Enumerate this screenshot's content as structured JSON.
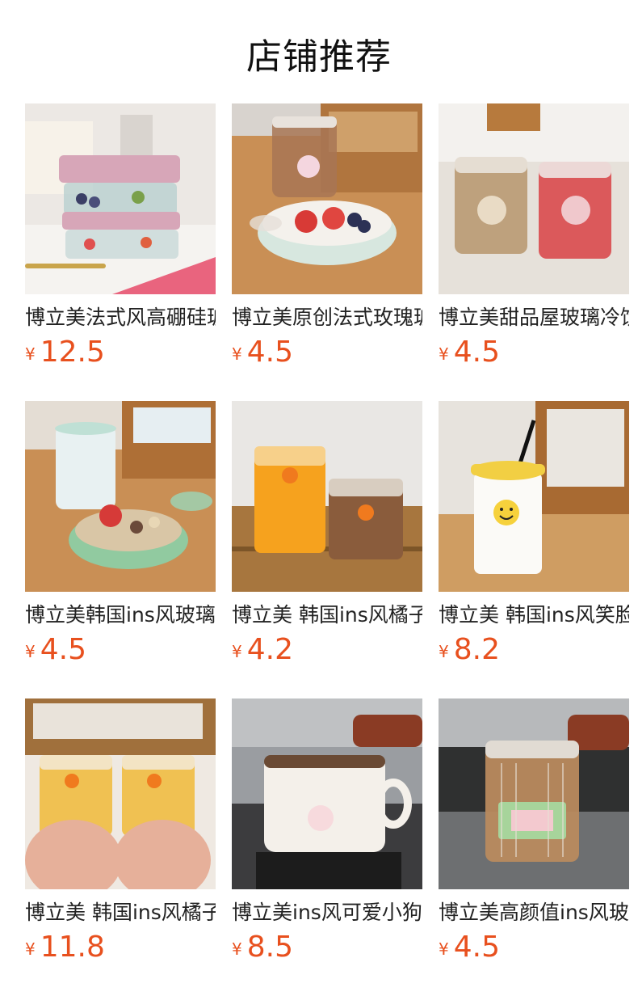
{
  "header": {
    "title": "店铺推荐"
  },
  "products": [
    {
      "name": "博立美法式风高硼硅玻璃保鲜盒",
      "currency": "¥",
      "price": "12.5"
    },
    {
      "name": "博立美原创法式玫瑰玻璃碗",
      "currency": "¥",
      "price": "4.5"
    },
    {
      "name": "博立美甜品屋玻璃冷饮杯",
      "currency": "¥",
      "price": "4.5"
    },
    {
      "name": "博立美韩国ins风玻璃碗",
      "currency": "¥",
      "price": "4.5"
    },
    {
      "name": "博立美 韩国ins风橘子玻璃杯",
      "currency": "¥",
      "price": "4.2"
    },
    {
      "name": "博立美 韩国ins风笑脸吸管杯",
      "currency": "¥",
      "price": "8.2"
    },
    {
      "name": "博立美 韩国ins风橘子小酒杯",
      "currency": "¥",
      "price": "11.8"
    },
    {
      "name": "博立美ins风可爱小狗咖啡杯",
      "currency": "¥",
      "price": "8.5"
    },
    {
      "name": "博立美高颜值ins风玻璃杯",
      "currency": "¥",
      "price": "4.5"
    }
  ]
}
